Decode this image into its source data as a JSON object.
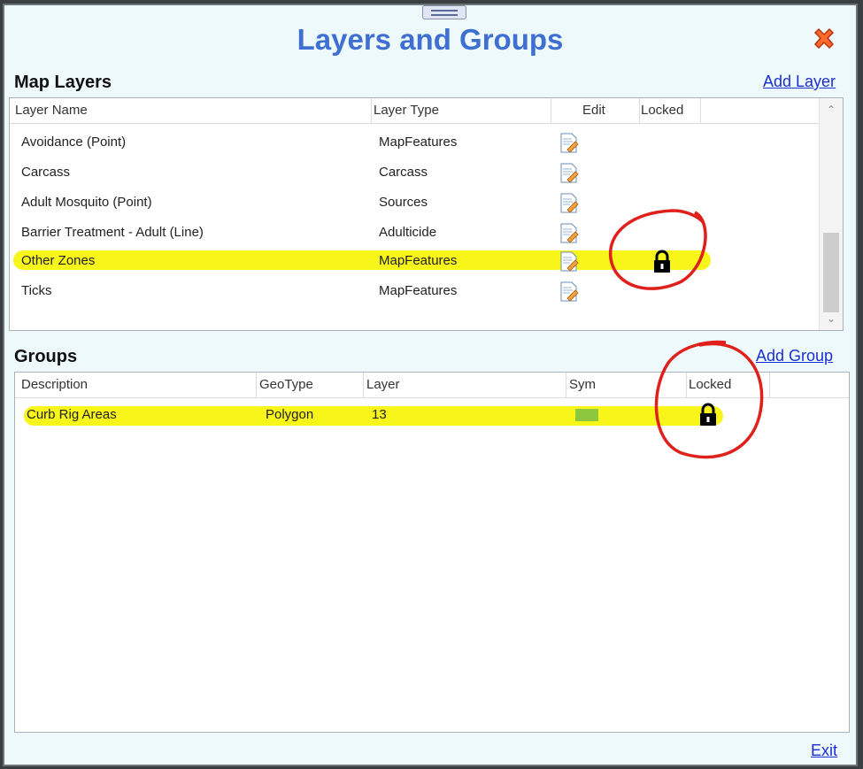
{
  "dialog": {
    "title": "Layers and Groups",
    "close_icon": "close-x-icon",
    "exit_label": "Exit"
  },
  "map_layers": {
    "section_title": "Map Layers",
    "add_label": "Add Layer",
    "columns": {
      "name": "Layer Name",
      "type": "Layer Type",
      "edit": "Edit",
      "locked": "Locked"
    },
    "rows": [
      {
        "name": "Avoidance (Point)",
        "type": "MapFeatures",
        "locked": false
      },
      {
        "name": "Carcass",
        "type": "Carcass",
        "locked": false
      },
      {
        "name": "Adult Mosquito (Point)",
        "type": "Sources",
        "locked": false
      },
      {
        "name": "Barrier Treatment - Adult (Line)",
        "type": "Adulticide",
        "locked": false
      },
      {
        "name": "Other Zones",
        "type": "MapFeatures",
        "locked": true
      },
      {
        "name": "Ticks",
        "type": "MapFeatures",
        "locked": false
      }
    ]
  },
  "groups": {
    "section_title": "Groups",
    "add_label": "Add Group",
    "columns": {
      "description": "Description",
      "geotype": "GeoType",
      "layer": "Layer",
      "sym": "Sym",
      "locked": "Locked"
    },
    "rows": [
      {
        "description": "Curb Rig Areas",
        "geotype": "Polygon",
        "layer": "13",
        "sym_color": "#8dc63f",
        "locked": true
      }
    ]
  },
  "colors": {
    "title": "#3f6fd1",
    "link": "#1a2fd0",
    "highlight": "#f6f400",
    "annotation": "#e0201b"
  }
}
